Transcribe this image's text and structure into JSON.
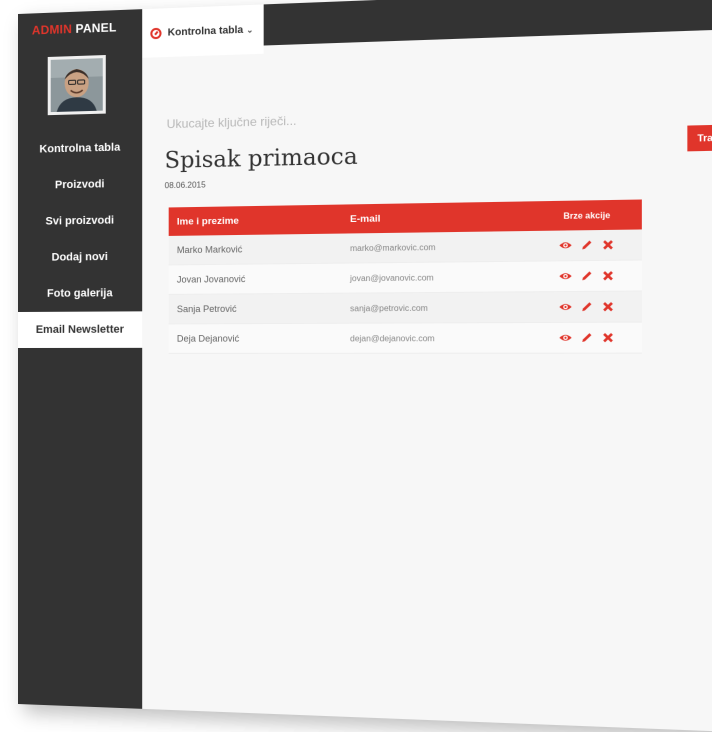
{
  "brand": {
    "part1": "ADMIN",
    "part2": "PANEL"
  },
  "sidebar": {
    "items": [
      {
        "label": "Kontrolna tabla"
      },
      {
        "label": "Proizvodi"
      },
      {
        "label": "Svi proizvodi"
      },
      {
        "label": "Dodaj novi"
      },
      {
        "label": "Foto galerija"
      },
      {
        "label": "Email Newsletter",
        "active": true
      }
    ]
  },
  "topbar": {
    "dashboard_label": "Kontrolna tabla",
    "caret": "⌄"
  },
  "search": {
    "placeholder": "Ukucajte ključne riječi...",
    "button_label": "Traži"
  },
  "page": {
    "title": "Spisak primaoca",
    "date": "08.06.2015"
  },
  "table": {
    "headers": [
      "Ime i prezime",
      "E-mail",
      "Brze akcije"
    ],
    "rows": [
      {
        "name": "Marko Marković",
        "email": "marko@markovic.com"
      },
      {
        "name": "Jovan Jovanović",
        "email": "jovan@jovanovic.com"
      },
      {
        "name": "Sanja Petrović",
        "email": "sanja@petrovic.com"
      },
      {
        "name": "Deja Dejanović",
        "email": "dejan@dejanovic.com"
      }
    ]
  },
  "colors": {
    "accent": "#e0352b",
    "sidebar_bg": "#333333"
  },
  "icons": [
    "eye-icon",
    "pencil-icon",
    "close-icon",
    "search-icon",
    "dashboard-icon"
  ]
}
